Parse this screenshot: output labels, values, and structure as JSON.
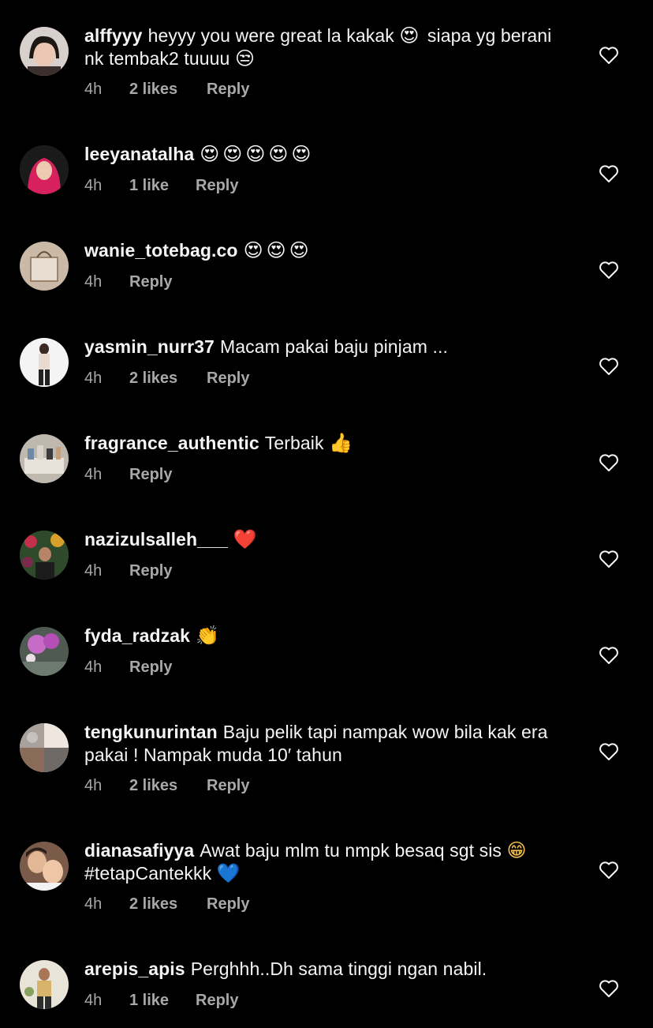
{
  "comments": [
    {
      "username": "alffyyy",
      "text": "heyyy you were great la kakak",
      "emoji1": "😍",
      "text2": "siapa yg berani nk tembak2 tuuuu",
      "emoji2": "😒",
      "time": "4h",
      "likes": "2 likes",
      "reply": "Reply"
    },
    {
      "username": "leeyanatalha",
      "text": "",
      "emoji1": "😍😍😍😍😍",
      "time": "4h",
      "likes": "1 like",
      "reply": "Reply"
    },
    {
      "username": "wanie_totebag.co",
      "text": "",
      "emoji1": "😍😍😍",
      "time": "4h",
      "likes": "",
      "reply": "Reply"
    },
    {
      "username": "yasmin_nurr37",
      "text": "Macam pakai baju pinjam ...",
      "emoji1": "",
      "time": "4h",
      "likes": "2 likes",
      "reply": "Reply"
    },
    {
      "username": "fragrance_authentic",
      "text": "Terbaik",
      "emoji1": "👍",
      "time": "4h",
      "likes": "",
      "reply": "Reply"
    },
    {
      "username": "nazizulsalleh___",
      "text": "",
      "emoji1": "❤️",
      "time": "4h",
      "likes": "",
      "reply": "Reply"
    },
    {
      "username": "fyda_radzak",
      "text": "",
      "emoji1": "👏",
      "time": "4h",
      "likes": "",
      "reply": "Reply"
    },
    {
      "username": "tengkunurintan",
      "text": "Baju pelik tapi nampak wow bila kak era pakai ! Nampak muda 10′ tahun",
      "emoji1": "",
      "time": "4h",
      "likes": "2 likes",
      "reply": "Reply"
    },
    {
      "username": "dianasafiyya",
      "text": "Awat baju mlm tu nmpk besaq sgt sis",
      "emoji1": "😁",
      "text2": "#tetapCantekkk",
      "emoji2": "💙",
      "time": "4h",
      "likes": "2 likes",
      "reply": "Reply"
    },
    {
      "username": "arepis_apis",
      "text": "Perghhh..Dh sama tinggi ngan nabil.",
      "emoji1": "",
      "time": "4h",
      "likes": "1 like",
      "reply": "Reply"
    }
  ],
  "colors": {
    "background": "#000000",
    "text": "#f5f5f5",
    "muted": "#a8a8a8",
    "emoji_heart": "#e0245e",
    "emoji_blue": "#2f7ad8"
  }
}
